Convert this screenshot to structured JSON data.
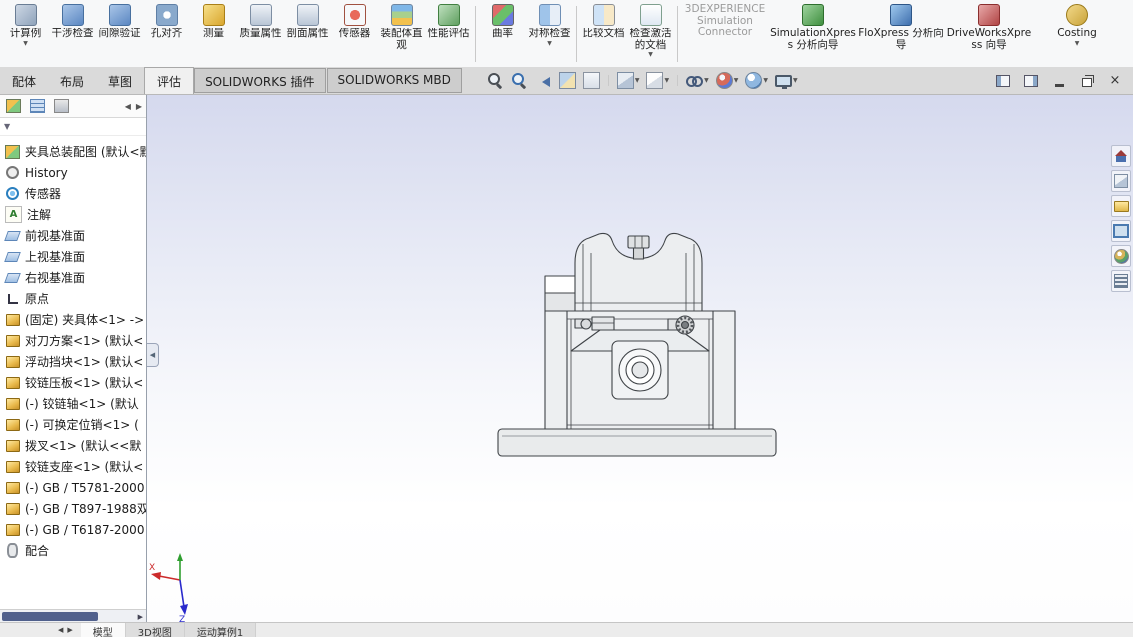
{
  "ui": {
    "caret_glyph": "▼",
    "arrow_left": "◀",
    "arrow_right": "▶",
    "close_glyph": "×"
  },
  "ribbon": {
    "items": [
      {
        "icon": "study-icon",
        "label": "计算例",
        "caret": true
      },
      {
        "icon": "interference-check-icon",
        "label": "干涉检查"
      },
      {
        "icon": "clearance-verification-icon",
        "label": "间隙验证"
      },
      {
        "icon": "hole-alignment-icon",
        "label": "孔对齐"
      },
      {
        "icon": "measure-icon",
        "label": "测量"
      },
      {
        "icon": "mass-properties-icon",
        "label": "质量属性"
      },
      {
        "icon": "section-properties-icon",
        "label": "剖面属性"
      },
      {
        "icon": "sensor-icon",
        "label": "传感器"
      },
      {
        "icon": "assembly-visualization-icon",
        "label": "装配体直观"
      },
      {
        "icon": "performance-evaluation-icon",
        "label": "性能评估"
      },
      {
        "sep": true
      },
      {
        "icon": "curvature-icon",
        "label": "曲率"
      },
      {
        "icon": "symmetry-check-icon",
        "label": "对称检查",
        "caret": true
      },
      {
        "sep": true
      },
      {
        "icon": "compare-documents-icon",
        "label": "比较文档"
      },
      {
        "icon": "check-active-document-icon",
        "label": "检查激活的文档",
        "caret": true
      },
      {
        "sep": true
      },
      {
        "icon": "simulation-connector-icon",
        "label": "3DEXPERIENCE Simulation Connector",
        "disabled": true,
        "wide": true,
        "noicon": true
      },
      {
        "icon": "simulationxpress-icon",
        "label": "SimulationXpress 分析向导",
        "wide": true
      },
      {
        "icon": "floxpress-icon",
        "label": "FloXpress 分析向导",
        "wide": true
      },
      {
        "icon": "driveworksxpress-icon",
        "label": "DriveWorksXpress 向导",
        "wide": true
      },
      {
        "icon": "costing-icon",
        "label": "Costing",
        "caret": true,
        "wide": true
      }
    ]
  },
  "command_tabs": {
    "items": [
      {
        "label": "配体"
      },
      {
        "label": "布局"
      },
      {
        "label": "草图"
      },
      {
        "label": "评估",
        "active": true
      },
      {
        "label": "SOLIDWORKS 插件",
        "boxed": true
      },
      {
        "label": "SOLIDWORKS MBD",
        "boxed": true
      }
    ]
  },
  "view_toolbar": {
    "items": [
      {
        "icon": "zoom-fit-icon"
      },
      {
        "icon": "zoom-area-icon"
      },
      {
        "icon": "previous-view-icon"
      },
      {
        "icon": "section-view-icon"
      },
      {
        "icon": "annotation-view-icon"
      },
      {
        "sep": true
      },
      {
        "icon": "view-orientation-icon",
        "caret": true
      },
      {
        "icon": "display-style-icon",
        "caret": true
      },
      {
        "sep": true
      },
      {
        "icon": "hide-show-items-icon",
        "caret": true
      },
      {
        "icon": "edit-appearance-icon",
        "caret": true
      },
      {
        "icon": "apply-scene-icon",
        "caret": true
      },
      {
        "icon": "view-settings-icon",
        "caret": true
      }
    ]
  },
  "feature_tree": {
    "items": [
      {
        "icon": "assembly-icon",
        "label": "夹具总装配图 (默认<默认"
      },
      {
        "icon": "history-icon",
        "label": "History"
      },
      {
        "icon": "sensors-icon",
        "label": "传感器"
      },
      {
        "icon": "annotations-icon",
        "label": "注解",
        "glyph": "A"
      },
      {
        "icon": "plane-icon",
        "label": "前视基准面"
      },
      {
        "icon": "plane-icon",
        "label": "上视基准面"
      },
      {
        "icon": "plane-icon",
        "label": "右视基准面"
      },
      {
        "icon": "origin-icon",
        "label": "原点"
      },
      {
        "icon": "part-icon",
        "label": "(固定) 夹具体<1> ->"
      },
      {
        "icon": "part-icon",
        "label": "对刀方案<1> (默认<"
      },
      {
        "icon": "part-icon",
        "label": "浮动挡块<1> (默认<"
      },
      {
        "icon": "part-icon",
        "label": "铰链压板<1> (默认<"
      },
      {
        "icon": "part-icon",
        "label": "(-) 铰链轴<1> (默认"
      },
      {
        "icon": "part-icon",
        "label": "(-) 可换定位销<1> ("
      },
      {
        "icon": "part-icon",
        "label": "拨叉<1> (默认<<默"
      },
      {
        "icon": "part-icon",
        "label": "铰链支座<1> (默认<"
      },
      {
        "icon": "part-icon",
        "label": "(-) GB / T5781-2000"
      },
      {
        "icon": "part-icon",
        "label": "(-) GB / T897-1988双"
      },
      {
        "icon": "part-icon",
        "label": "(-) GB / T6187-2000"
      },
      {
        "icon": "mates-icon",
        "label": "配合"
      }
    ]
  },
  "panel_tabs": {
    "items": [
      {
        "icon": "featuremanager-tab-icon",
        "active": true
      },
      {
        "icon": "propertymanager-tab-icon"
      },
      {
        "icon": "configurationmanager-tab-icon"
      }
    ]
  },
  "right_toolbar": {
    "items": [
      {
        "icon": "home-icon"
      },
      {
        "icon": "view-selector-icon"
      },
      {
        "icon": "open-folder-icon"
      },
      {
        "icon": "tab-gallery-icon"
      },
      {
        "icon": "appearance-sphere-icon"
      },
      {
        "icon": "display-pane-icon"
      }
    ]
  },
  "bottom_bar": {
    "tabs": [
      {
        "label": "模型",
        "active": true
      },
      {
        "label": "3D视图"
      },
      {
        "label": "运动算例1"
      }
    ]
  },
  "viewport": {
    "triad": {
      "x_label": "X",
      "z_label": "Z"
    }
  }
}
